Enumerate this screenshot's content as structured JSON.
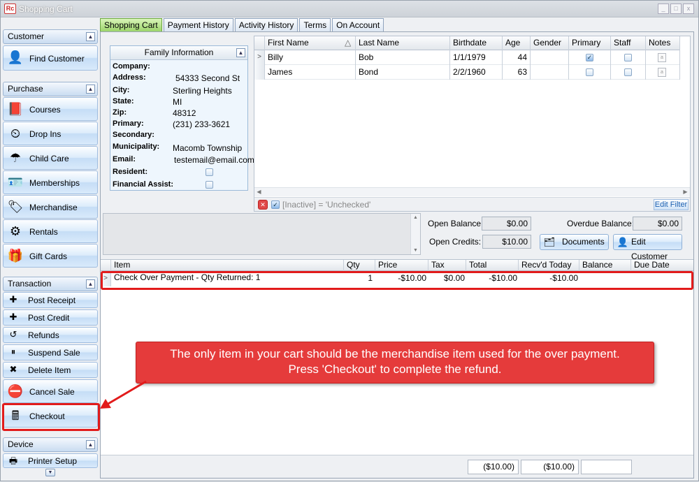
{
  "window": {
    "title": "Shopping Cart",
    "logo_text": "Rc",
    "controls": [
      "_",
      "□",
      "x"
    ]
  },
  "sidebar": {
    "groups": [
      {
        "label": "Customer",
        "items": [
          {
            "label": "Find Customer",
            "icon": "person-icon",
            "glyph": "👤"
          }
        ]
      },
      {
        "label": "Purchase",
        "items": [
          {
            "label": "Courses",
            "icon": "book-icon",
            "glyph": "📕"
          },
          {
            "label": "Drop Ins",
            "icon": "clock-icon",
            "glyph": "⏲"
          },
          {
            "label": "Child Care",
            "icon": "childcare-icon",
            "glyph": "☂"
          },
          {
            "label": "Memberships",
            "icon": "id-card-icon",
            "glyph": "🪪"
          },
          {
            "label": "Merchandise",
            "icon": "tag-icon",
            "glyph": "🏷"
          },
          {
            "label": "Rentals",
            "icon": "rentals-icon",
            "glyph": "⚙"
          },
          {
            "label": "Gift Cards",
            "icon": "gift-icon",
            "glyph": "🎁"
          }
        ]
      },
      {
        "label": "Transaction",
        "items": [
          {
            "label": "Post Receipt",
            "icon": "coins-plus-icon",
            "glyph": "✚"
          },
          {
            "label": "Post Credit",
            "icon": "coins-icon",
            "glyph": "✚"
          },
          {
            "label": "Refunds",
            "icon": "refund-icon",
            "glyph": "↺"
          },
          {
            "label": "Suspend Sale",
            "icon": "suspend-icon",
            "glyph": "⏸"
          },
          {
            "label": "Delete Item",
            "icon": "delete-icon",
            "glyph": "✖"
          },
          {
            "label": "Cancel Sale",
            "icon": "cancel-sale-icon",
            "glyph": "⛔"
          },
          {
            "label": "Checkout",
            "icon": "register-icon",
            "glyph": "🖩"
          }
        ]
      },
      {
        "label": "Device",
        "items": [
          {
            "label": "Printer Setup",
            "icon": "printer-icon",
            "glyph": "🖶"
          }
        ]
      }
    ]
  },
  "tabs": [
    {
      "label": "Shopping Cart",
      "active": true
    },
    {
      "label": "Payment History",
      "active": false
    },
    {
      "label": "Activity History",
      "active": false
    },
    {
      "label": "Terms",
      "active": false
    },
    {
      "label": "On Account",
      "active": false
    }
  ],
  "family": {
    "header": "Family Information",
    "fields": [
      {
        "key": "Company:",
        "value": ""
      },
      {
        "key": "Address:",
        "value": "54333 Second St"
      },
      {
        "key": "City:",
        "value": "Sterling Heights"
      },
      {
        "key": "State:",
        "value": "MI"
      },
      {
        "key": "Zip:",
        "value": "48312"
      },
      {
        "key": "Primary:",
        "value": "(231) 233-3621"
      },
      {
        "key": "Secondary:",
        "value": ""
      },
      {
        "key": "Municipality:",
        "value": "Macomb Township"
      },
      {
        "key": "Email:",
        "value": "testemail@email.com"
      },
      {
        "key": "Resident:",
        "checkbox": false
      },
      {
        "key": "Financial Assist:",
        "checkbox": false
      }
    ]
  },
  "members": {
    "columns": [
      "First Name",
      "Last Name",
      "Birthdate",
      "Age",
      "Gender",
      "Primary",
      "Staff",
      "Notes"
    ],
    "sort_indicator": "△",
    "rows": [
      {
        "first": "Billy",
        "last": "Bob",
        "birthdate": "1/1/1979",
        "age": "44",
        "gender": "",
        "primary": true,
        "staff": false
      },
      {
        "first": "James",
        "last": "Bond",
        "birthdate": "2/2/1960",
        "age": "63",
        "gender": "",
        "primary": false,
        "staff": false
      }
    ],
    "filter_text": "[Inactive] = 'Unchecked'",
    "edit_filter_label": "Edit Filter"
  },
  "balances": {
    "open_balance_label": "Open Balance:",
    "open_balance": "$0.00",
    "overdue_balance_label": "Overdue Balance:",
    "overdue_balance": "$0.00",
    "open_credits_label": "Open Credits:",
    "open_credits": "$10.00",
    "documents_label": "Documents",
    "edit_customer_label": "Edit Customer"
  },
  "cart": {
    "columns": [
      "Item",
      "Qty",
      "Price",
      "Tax",
      "Total",
      "Recv'd Today",
      "Balance",
      "Due Date"
    ],
    "rows": [
      {
        "item": "Check Over Payment - Qty Returned: 1",
        "qty": "1",
        "price": "-$10.00",
        "tax": "$0.00",
        "total": "-$10.00",
        "recvd": "-$10.00",
        "balance": "",
        "due": ""
      }
    ],
    "footer_total": "($10.00)",
    "footer_recvd": "($10.00)",
    "footer_balance": ""
  },
  "callout": {
    "line1": "The only item in your cart should be the merchandise item used for the over payment.",
    "line2": "Press 'Checkout' to complete the refund."
  },
  "colors": {
    "highlight": "#e21b1b",
    "callout_bg": "#e53b3b",
    "active_tab": "#9cd46b"
  }
}
